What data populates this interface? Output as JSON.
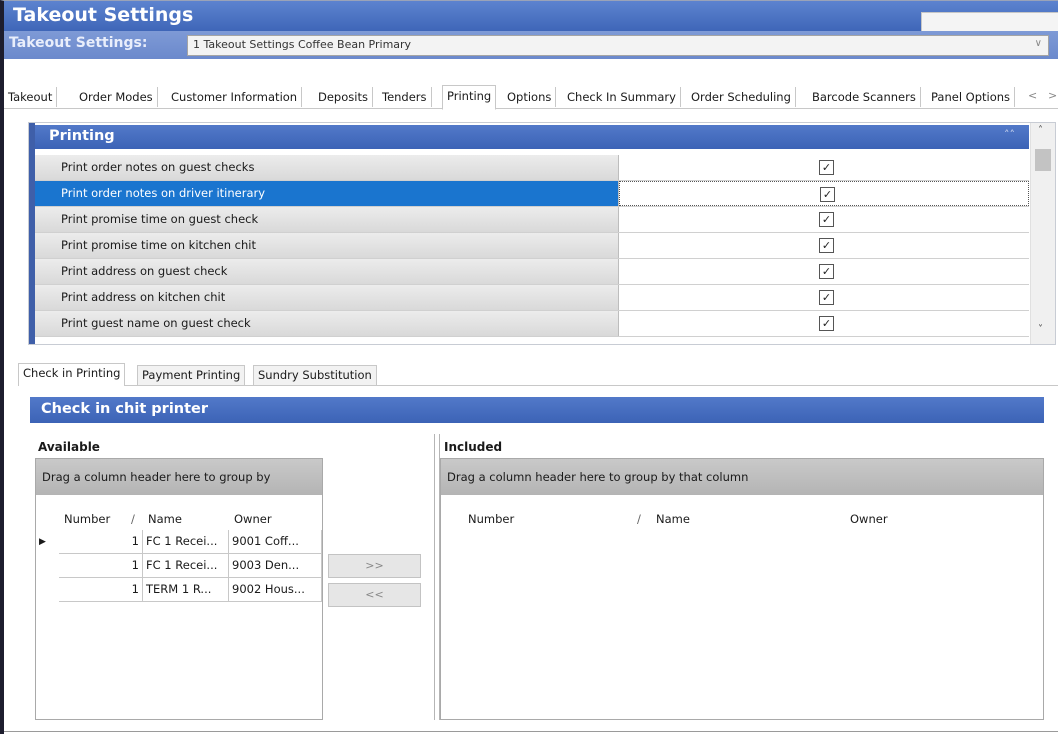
{
  "window": {
    "title": "Takeout Settings"
  },
  "settings_selector": {
    "label": "Takeout Settings:",
    "value": "1 Takeout Settings Coffee Bean Primary"
  },
  "top_tabs": [
    "Takeout",
    "Order Modes",
    "Customer Information",
    "Deposits",
    "Tenders",
    "Printing",
    "Options",
    "Check In Summary",
    "Order Scheduling",
    "Barcode Scanners",
    "Panel Options"
  ],
  "active_top_tab": "Printing",
  "printing_grid": {
    "title": "Printing",
    "rows": [
      {
        "label": "Print order notes on guest checks",
        "checked": true
      },
      {
        "label": "Print order notes on driver itinerary",
        "checked": true,
        "selected": true
      },
      {
        "label": "Print promise time on guest check",
        "checked": true
      },
      {
        "label": "Print promise time on kitchen chit",
        "checked": true
      },
      {
        "label": "Print address on guest check",
        "checked": true
      },
      {
        "label": "Print address on kitchen chit",
        "checked": true
      },
      {
        "label": "Print guest name on guest check",
        "checked": true
      }
    ]
  },
  "bottom_tabs": [
    "Check in Printing",
    "Payment Printing",
    "Sundry Substitution"
  ],
  "active_bottom_tab": "Check in Printing",
  "chit_printer": {
    "title": "Check in chit printer",
    "available": {
      "label": "Available",
      "group_hint": "Drag a column header here to group by",
      "columns": [
        "Number",
        "Name",
        "Owner"
      ],
      "rows": [
        {
          "number": "1",
          "name": "FC 1 Recei...",
          "owner": "9001 Coff..."
        },
        {
          "number": "1",
          "name": "FC 1 Recei...",
          "owner": "9003 Den..."
        },
        {
          "number": "1",
          "name": "TERM 1 R...",
          "owner": "9002 Hous..."
        }
      ]
    },
    "move_right_label": ">>",
    "move_left_label": "<<",
    "included": {
      "label": "Included",
      "group_hint": "Drag a column header here to group by that column",
      "columns": [
        "Number",
        "Name",
        "Owner"
      ],
      "rows": []
    }
  },
  "icons": {
    "dropdown": "chevron-down-icon",
    "collapse": "double-chevron-up-icon",
    "scroll_up": "chevron-up-icon",
    "scroll_down": "chevron-down-icon",
    "row_pointer": "triangle-right-icon",
    "sort": "sort-indicator-icon",
    "tab_prev": "chevron-left-icon",
    "tab_next": "chevron-right-icon"
  },
  "colors": {
    "header_blue": "#3f66b8",
    "selection_blue": "#1a75cf",
    "settings_band": "#6b89cc"
  }
}
